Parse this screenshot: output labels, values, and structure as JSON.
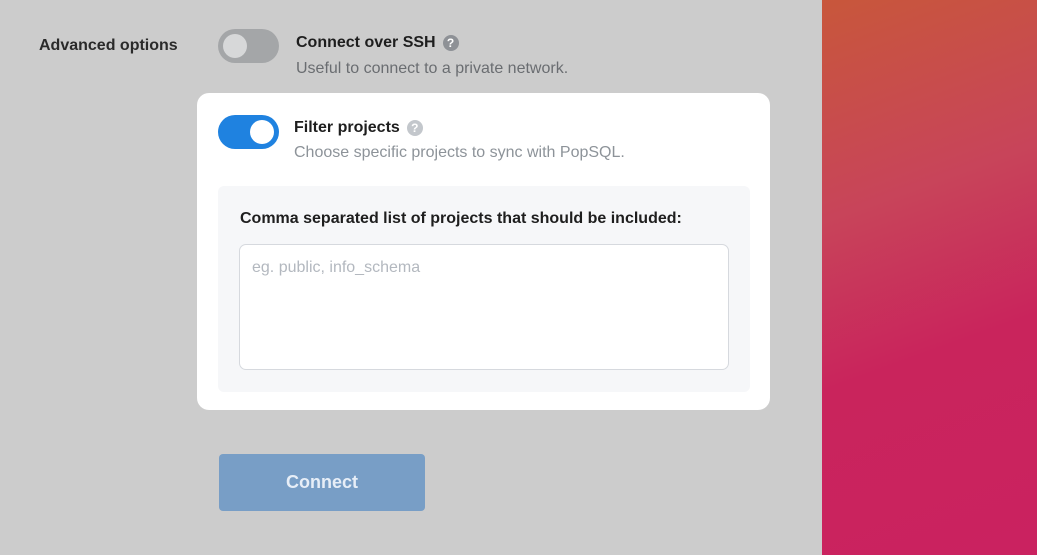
{
  "advanced_options": {
    "label": "Advanced options"
  },
  "ssh_option": {
    "title": "Connect over SSH",
    "description": "Useful to connect to a private network.",
    "enabled": false,
    "help_icon": "question-circle-icon"
  },
  "filter_option": {
    "title": "Filter projects",
    "description": "Choose specific projects to sync with PopSQL.",
    "enabled": true,
    "help_icon": "question-circle-icon",
    "list_label": "Comma separated list of projects that should be included:",
    "input_placeholder": "eg. public, info_schema",
    "input_value": ""
  },
  "connect_button": {
    "label": "Connect"
  },
  "colors": {
    "toggle_on": "#1f82e0",
    "toggle_off": "#a4a6a8",
    "button_disabled": "#789ec6",
    "accent_gradient_start": "#c8573b",
    "accent_gradient_end": "#ca2260"
  }
}
